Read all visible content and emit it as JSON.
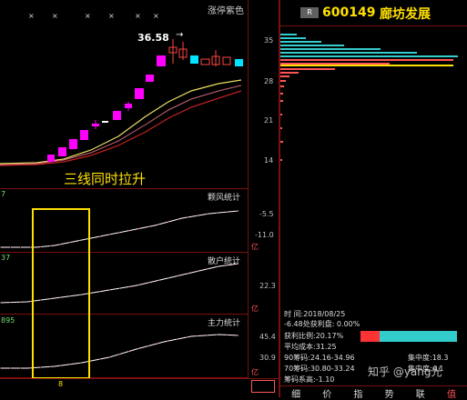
{
  "top_panel": {
    "color_mode_label": "涨停紫色",
    "x_markers": [
      "×",
      "×",
      "×",
      "×",
      "×",
      "×"
    ],
    "peak_price": "36.58",
    "peak_arrow": "→",
    "annotation": "三线同时拉升",
    "price_axis": [
      "35",
      "28",
      "21",
      "14"
    ]
  },
  "ind1": {
    "title": "颗风统计",
    "tick_left": "7",
    "ticks": [
      "-5.5",
      "-11.0"
    ],
    "unit": "亿"
  },
  "ind2": {
    "title": "散户统计",
    "tick_left": "37",
    "ticks": [
      "22.3"
    ],
    "unit": "亿"
  },
  "ind3": {
    "title": "主力统计",
    "tick_left": "895",
    "ticks": [
      "45.4",
      "30.9"
    ],
    "unit": "亿"
  },
  "x_axis_label": "8",
  "right": {
    "code_badge": "R",
    "stock_code": "600149",
    "stock_name": "廊坊发展",
    "info": {
      "date_label": "时       间:2018/08/25",
      "profit_line": "-6.48处获利盘: 0.00%",
      "ratio_line": "获利比例:20.17%",
      "avg_cost": "平均成本:31.25",
      "chip90": "90筹码:24.16-34.96",
      "concentration90": "集中度:18.3",
      "chip70": "70筹码:30.80-33.24",
      "concentration70": "集中度:4.1",
      "chip_rate": "筹码系高:-1.10"
    },
    "tabs": [
      "细",
      "价",
      "指",
      "势",
      "联",
      "值"
    ],
    "watermark": "知乎 @yang光"
  },
  "colors": {
    "up_candle": "#ff00ff",
    "down_candle": "#00e5ff",
    "ma_yellow": "#e8e060",
    "ma_red": "#c82020",
    "chip_cyan": "#33cccc",
    "annotation_box": "#ffe000"
  }
}
